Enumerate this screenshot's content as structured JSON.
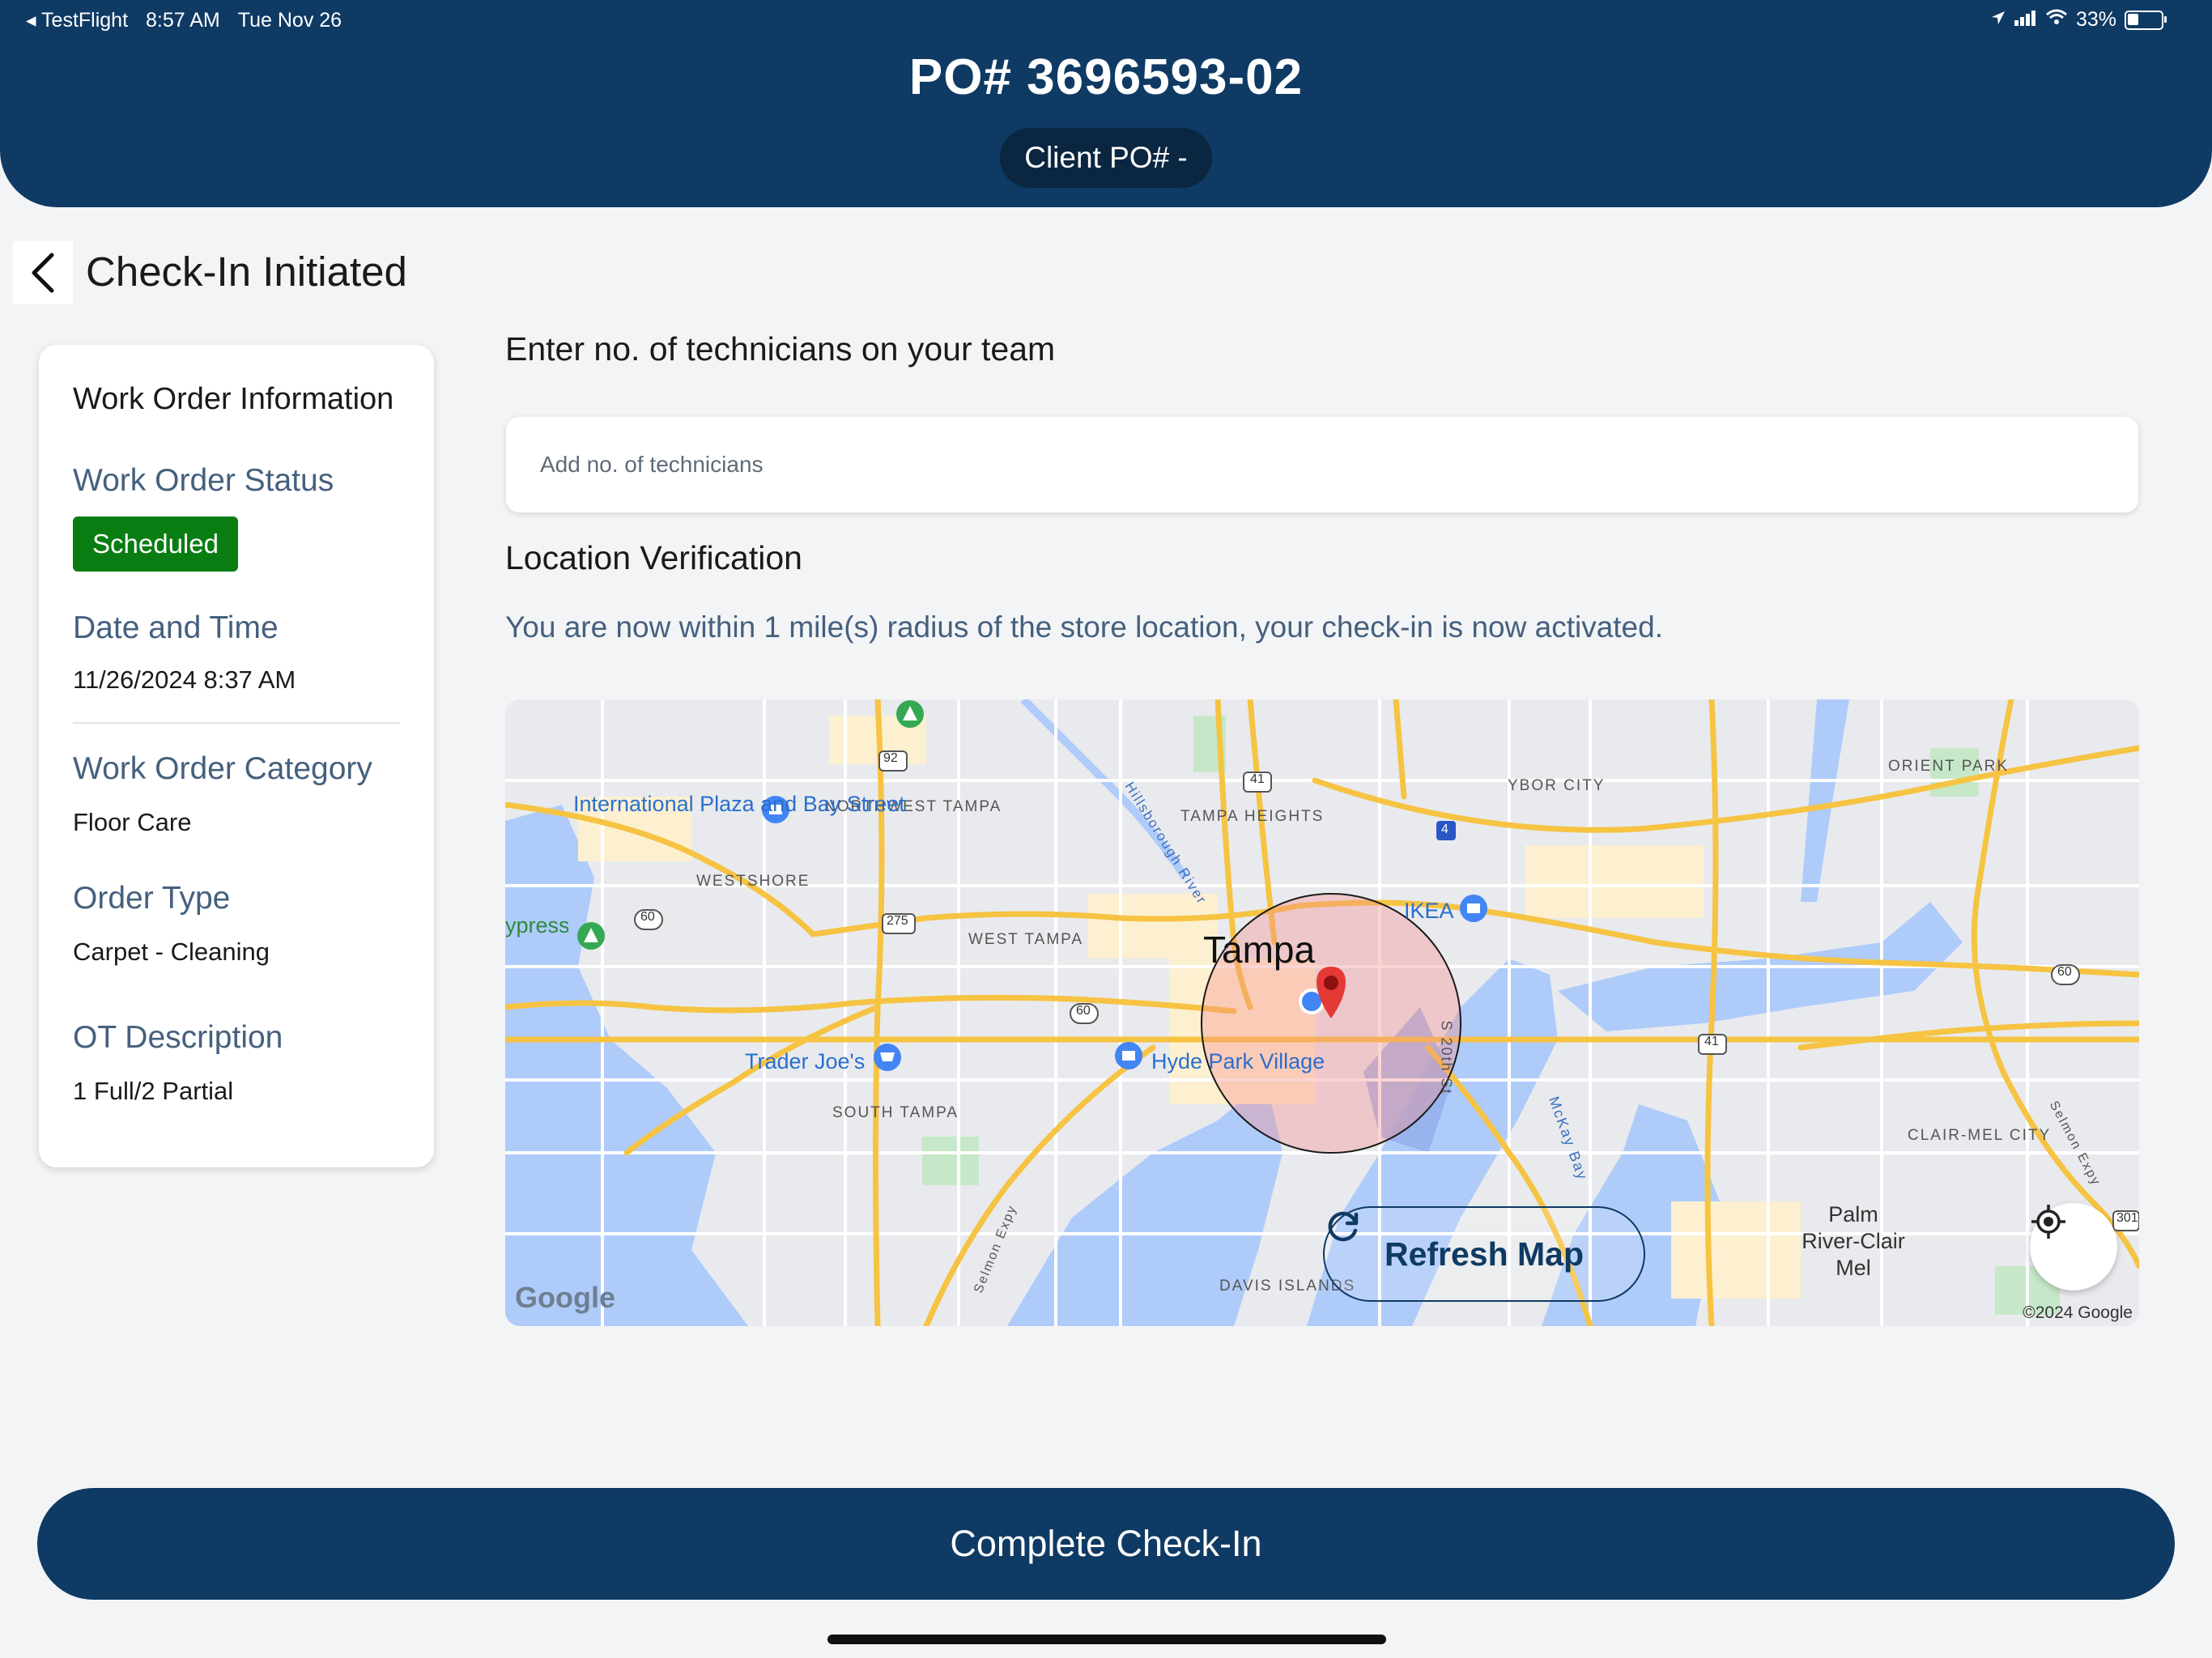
{
  "status_bar": {
    "back_app": "◂ TestFlight",
    "time": "8:57 AM",
    "date": "Tue Nov 26",
    "battery_text": "33%",
    "battery_level": 0.33
  },
  "header": {
    "po_number": "PO# 3696593-02",
    "client_po": "Client PO# -"
  },
  "page": {
    "title": "Check-In Initiated"
  },
  "work_order": {
    "card_title": "Work Order Information",
    "status_label": "Work Order Status",
    "status_value": "Scheduled",
    "datetime_label": "Date and Time",
    "datetime_value": "11/26/2024 8:37 AM",
    "category_label": "Work Order Category",
    "category_value": "Floor Care",
    "order_type_label": "Order Type",
    "order_type_value": "Carpet - Cleaning",
    "ot_desc_label": "OT Description",
    "ot_desc_value": "1 Full/2 Partial"
  },
  "technicians": {
    "heading": "Enter no. of technicians on your team",
    "placeholder": "Add no. of technicians",
    "value": ""
  },
  "location": {
    "heading": "Location Verification",
    "message": "You are now within 1 mile(s) radius of the store location, your check-in is now activated."
  },
  "map": {
    "city": "Tampa",
    "neighborhoods": [
      "NORTHWEST TAMPA",
      "WESTSHORE",
      "WEST TAMPA",
      "SOUTH TAMPA",
      "TAMPA HEIGHTS",
      "YBOR CITY",
      "ORIENT PARK",
      "CLAIR-MEL CITY",
      "DAVIS ISLANDS"
    ],
    "pois": [
      "International Plaza and Bay Street",
      "Trader Joe's",
      "Hyde Park Village",
      "IKEA"
    ],
    "park": "ypress Point Park",
    "place": "Palm River-Clair Mel",
    "streets": [
      "Hillsborough River",
      "S 20th St",
      "McKay Bay",
      "Selmon Expy",
      "Selmon Expy"
    ],
    "route_shields": [
      "92",
      "41",
      "275",
      "60",
      "60",
      "60",
      "41",
      "4",
      "301"
    ],
    "refresh_label": "Refresh Map",
    "google_logo": "Google",
    "copyright": "©2024 Google"
  },
  "footer": {
    "complete_label": "Complete Check-In"
  },
  "colors": {
    "header_bg": "#0f3a64",
    "status_badge": "#0a7d12",
    "label_color": "#45607e",
    "pin": "#e53935"
  }
}
